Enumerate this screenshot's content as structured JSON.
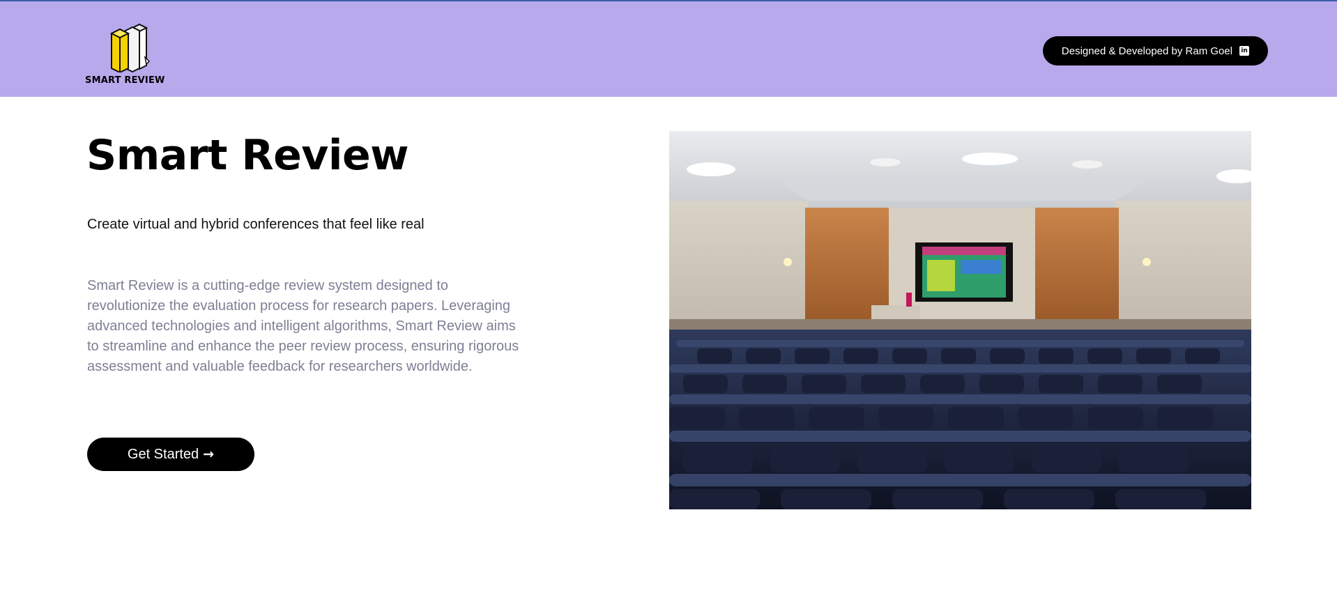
{
  "header": {
    "logo_text": "SMART REVIEW",
    "logo_icon": "books-icon",
    "credit_label": "Designed & Developed by Ram Goel",
    "credit_icon": "linkedin-icon",
    "linkedin_glyph": "in"
  },
  "hero": {
    "title": "Smart Review",
    "subtitle": "Create virtual and hybrid conferences that feel like real",
    "description": "Smart Review is a cutting-edge review system designed to revolutionize the evaluation process for research papers. Leveraging advanced technologies and intelligent algorithms, Smart Review aims to streamline and enhance the peer review process, ensuring rigorous assessment and valuable feedback for researchers worldwide.",
    "cta_label": "Get Started",
    "cta_icon": "arrow-right-icon",
    "cta_arrow": "→",
    "image_subject": "conference-auditorium-photo"
  },
  "colors": {
    "header_bg": "#b8a9ec",
    "button_bg": "#000000",
    "description_text": "#7d7f94",
    "logo_yellow": "#f5d100"
  }
}
